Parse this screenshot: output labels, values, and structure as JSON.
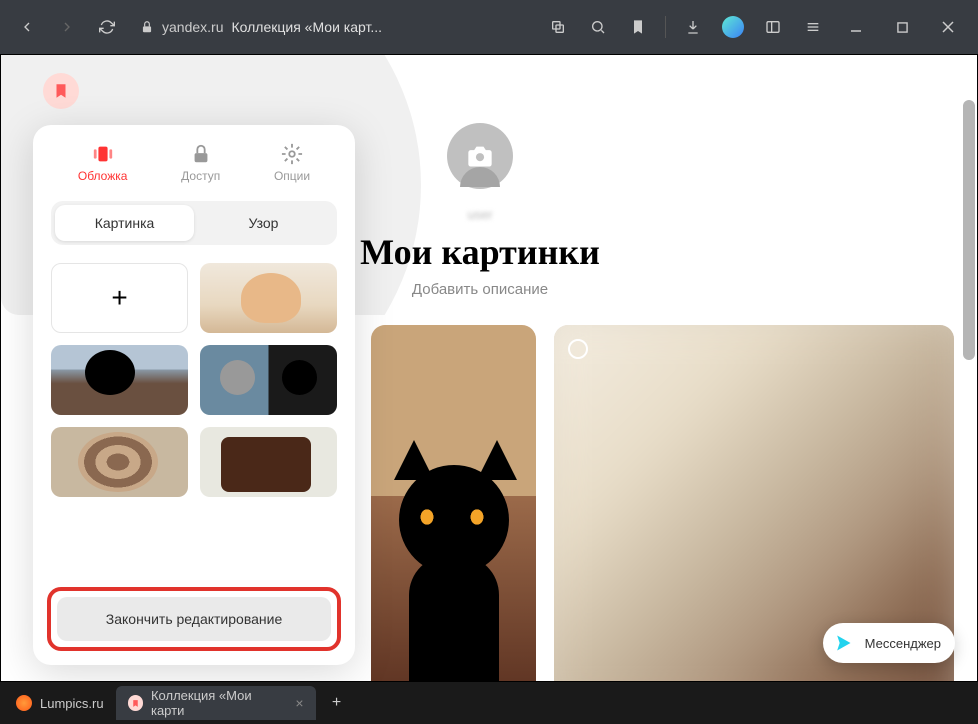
{
  "browser": {
    "domain": "yandex.ru",
    "page_title": "Коллекция «Мои карт...",
    "tabs": [
      {
        "label": "Lumpics.ru"
      },
      {
        "label": "Коллекция «Мои карти"
      }
    ]
  },
  "collection": {
    "title": "Мои картинки",
    "subtitle": "Добавить описание",
    "username": "user"
  },
  "panel": {
    "tabs": {
      "cover": "Обложка",
      "access": "Доступ",
      "options": "Опции"
    },
    "subtabs": {
      "picture": "Картинка",
      "pattern": "Узор"
    },
    "add_label": "+",
    "finish_label": "Закончить редактирование"
  },
  "messenger": {
    "label": "Мессенджер"
  },
  "colors": {
    "accent": "#ff3333",
    "highlight": "#e1332c"
  }
}
